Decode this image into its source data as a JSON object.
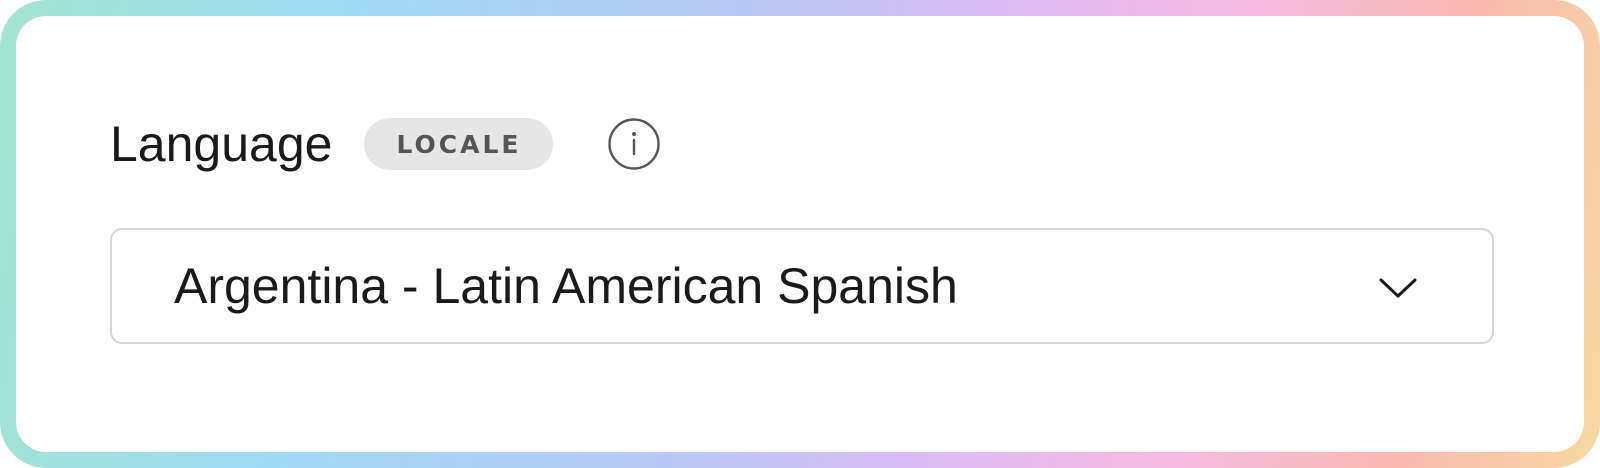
{
  "field": {
    "label": "Language",
    "badge": "LOCALE",
    "info_icon": "info-icon"
  },
  "select": {
    "value": "Argentina - Latin American Spanish",
    "chevron_icon": "chevron-down-icon"
  },
  "colors": {
    "badge_bg": "#e6e6e6",
    "badge_text": "#555555",
    "text": "#1a1a1a",
    "border": "#d6d6d6"
  }
}
